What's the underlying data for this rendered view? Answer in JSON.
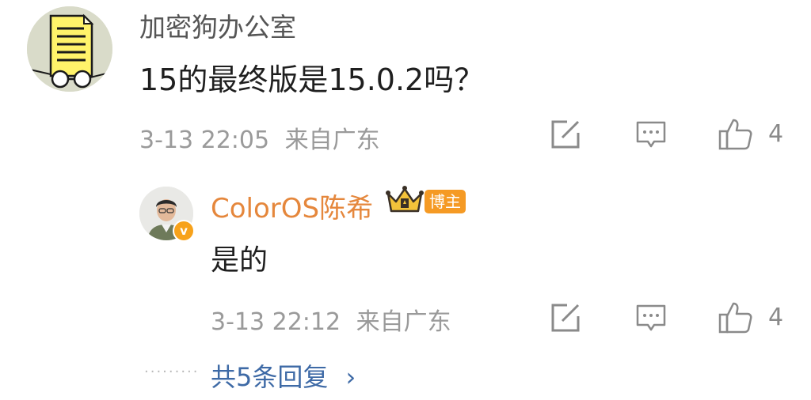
{
  "comment": {
    "username": "加密狗办公室",
    "text": "15的最终版是15.0.2吗？",
    "timestamp": "3-13 22:05",
    "location": "来自广东",
    "like_count": "4",
    "avatar_icon": "document-with-glasses-icon"
  },
  "reply": {
    "username": "ColorOS陈希",
    "badge_label": "博主",
    "text": "是的",
    "timestamp": "3-13 22:12",
    "location": "来自广东",
    "like_count": "4",
    "verified_mark": "v"
  },
  "more_replies": {
    "label": "共5条回复",
    "chevron": "›"
  },
  "colors": {
    "reply_username": "#e5873c",
    "link": "#3e6aa6",
    "meta": "#9a9a9a",
    "badge": "#f59a24"
  },
  "icons": [
    "share-icon",
    "comment-icon",
    "like-icon",
    "crown-icon",
    "verified-icon",
    "chevron-right-icon"
  ]
}
